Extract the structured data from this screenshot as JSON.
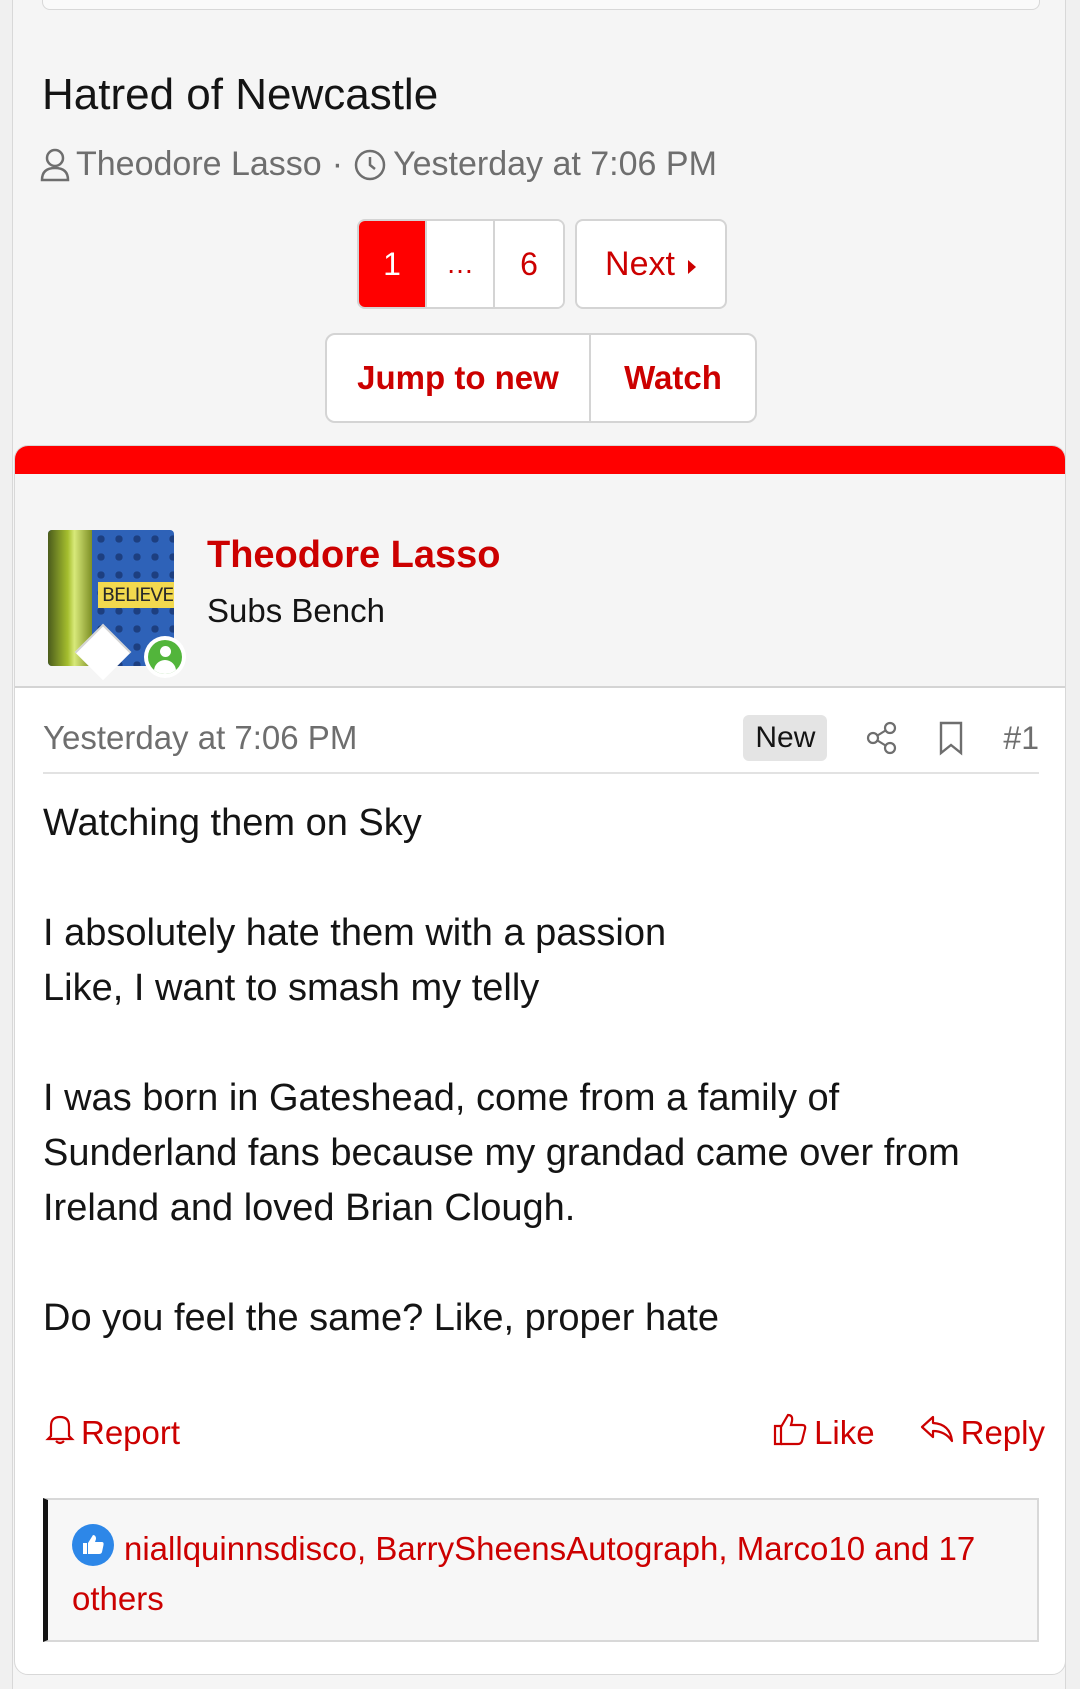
{
  "thread": {
    "title": "Hatred of Newcastle",
    "author": "Theodore Lasso",
    "separator": "·",
    "date": "Yesterday at 7:06 PM"
  },
  "pagination": {
    "current": "1",
    "ellipsis": "…",
    "last": "6",
    "next_label": "Next"
  },
  "thread_actions": {
    "jump_label": "Jump to new",
    "watch_label": "Watch"
  },
  "post": {
    "username": "Theodore Lasso",
    "user_title": "Subs Bench",
    "avatar_text": "BELIEVE",
    "date": "Yesterday at 7:06 PM",
    "badge": "New",
    "number": "#1",
    "body": [
      "Watching them on Sky",
      "",
      "I absolutely hate them with a passion",
      "Like, I want to smash my telly",
      "",
      "I was born in Gateshead, come from a family of",
      "Sunderland fans because my grandad came over from",
      "Ireland and loved Brian Clough.",
      "",
      "Do you feel the same? Like, proper hate"
    ],
    "report_label": "Report",
    "like_label": "Like",
    "reply_label": "Reply",
    "reactions_text": "niallquinnsdisco, BarrySheensAutograph, Marco10 and 17 others"
  },
  "colors": {
    "accent": "#cc0000",
    "bar": "#ff0000",
    "online": "#52b53b",
    "like": "#2d87e8"
  }
}
